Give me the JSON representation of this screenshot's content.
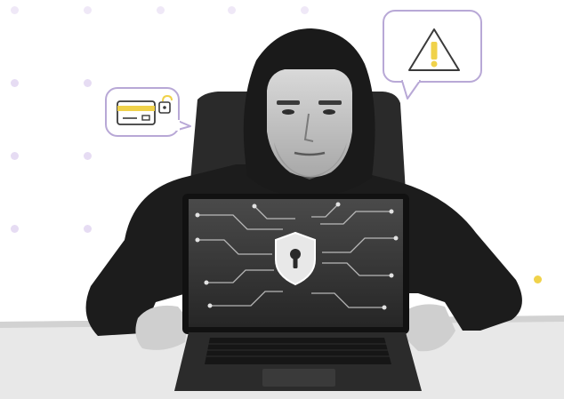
{
  "scene": {
    "description_tags": [
      "hooded-person",
      "laptop",
      "security-shield"
    ],
    "colors": {
      "accent_yellow": "#f0d24a",
      "accent_purple": "#b8a8d6",
      "dot_purple": "#e6dcf3",
      "hoodie": "#1c1c1c",
      "screen": "#3a3a3a",
      "desk": "#e4e4e4"
    }
  },
  "icons": {
    "card_bubble": "credit-card-unlock-icon",
    "warning_bubble": "warning-icon",
    "screen_shield": "shield-keyhole-icon"
  }
}
